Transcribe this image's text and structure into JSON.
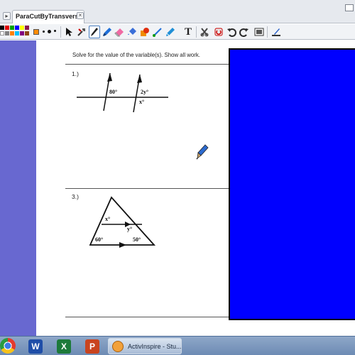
{
  "tabs": [
    {
      "label": "ParaCutByTransversal"
    }
  ],
  "toolbar": {
    "palette_colors": [
      "#000000",
      "#ff0000",
      "#00a000",
      "#0000ff",
      "#ffff00",
      "#ff00ff",
      "#ffffff",
      "#808080",
      "#ff8000",
      "#00ffff",
      "#800080",
      "#8b4513"
    ],
    "tools": [
      "select-arrow-icon",
      "resize-tool-icon",
      "pen-tool-icon",
      "highlighter-icon",
      "eraser-icon",
      "fill-tool-icon",
      "shape-tool-icon",
      "connector-icon",
      "magic-ink-icon",
      "text-tool-icon",
      "clear-icon",
      "reset-page-icon",
      "undo-icon",
      "redo-icon",
      "camera-icon",
      "desktop-annotate-icon"
    ],
    "text_tool_glyph": "T"
  },
  "flipchart": {
    "instructions": "Solve for the value of the variable(s).  Show all work.",
    "problem1": {
      "number": "1.)",
      "labels": {
        "angle_a": "80°",
        "angle_b": "2y°",
        "angle_c": "x°"
      }
    },
    "problem3": {
      "number": "3.)",
      "labels": {
        "angle_x": "x°",
        "angle_y": "y°",
        "angle_60": "60°",
        "angle_50": "50°"
      }
    },
    "panel_color": "#0000ff"
  },
  "taskbar": {
    "apps": [
      "chrome-icon",
      "word-icon",
      "excel-icon",
      "powerpoint-icon"
    ],
    "active_app": {
      "label": "ActivInspire - Stu..."
    }
  }
}
